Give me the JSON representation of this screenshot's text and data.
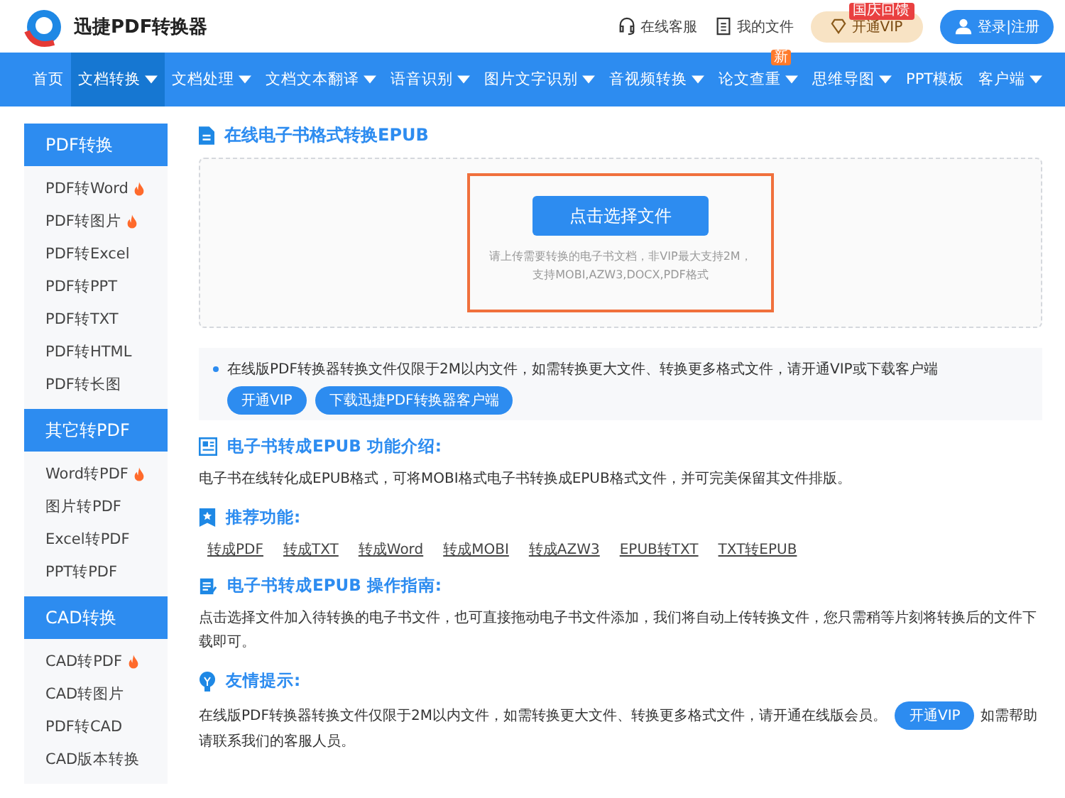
{
  "header": {
    "brand": "迅捷PDF转换器",
    "links": [
      {
        "kind": "service",
        "label": "在线客服"
      },
      {
        "kind": "files",
        "label": "我的文件"
      }
    ],
    "vip": {
      "label": "开通VIP",
      "badge": "国庆回馈"
    },
    "login": "登录|注册"
  },
  "nav": [
    {
      "label": "首页",
      "dropdown": false,
      "selected": false
    },
    {
      "label": "文档转换",
      "dropdown": true,
      "selected": true
    },
    {
      "label": "文档处理",
      "dropdown": true,
      "selected": false
    },
    {
      "label": "文档文本翻译",
      "dropdown": true,
      "selected": false
    },
    {
      "label": "语音识别",
      "dropdown": true,
      "selected": false
    },
    {
      "label": "图片文字识别",
      "dropdown": true,
      "selected": false
    },
    {
      "label": "音视频转换",
      "dropdown": true,
      "selected": false
    },
    {
      "label": "论文查重",
      "dropdown": true,
      "selected": false,
      "badge": "新"
    },
    {
      "label": "思维导图",
      "dropdown": true,
      "selected": false
    },
    {
      "label": "PPT模板",
      "dropdown": false,
      "selected": false
    },
    {
      "label": "客户端",
      "dropdown": true,
      "selected": false
    }
  ],
  "sidebar": [
    {
      "title": "PDF转换",
      "items": [
        {
          "label": "PDF转Word",
          "hot": true
        },
        {
          "label": "PDF转图片",
          "hot": true
        },
        {
          "label": "PDF转Excel",
          "hot": false
        },
        {
          "label": "PDF转PPT",
          "hot": false
        },
        {
          "label": "PDF转TXT",
          "hot": false
        },
        {
          "label": "PDF转HTML",
          "hot": false
        },
        {
          "label": "PDF转长图",
          "hot": false
        }
      ]
    },
    {
      "title": "其它转PDF",
      "items": [
        {
          "label": "Word转PDF",
          "hot": true
        },
        {
          "label": "图片转PDF",
          "hot": false
        },
        {
          "label": "Excel转PDF",
          "hot": false
        },
        {
          "label": "PPT转PDF",
          "hot": false
        }
      ]
    },
    {
      "title": "CAD转换",
      "items": [
        {
          "label": "CAD转PDF",
          "hot": true
        },
        {
          "label": "CAD转图片",
          "hot": false
        },
        {
          "label": "PDF转CAD",
          "hot": false
        },
        {
          "label": "CAD版本转换",
          "hot": false
        }
      ]
    }
  ],
  "page_title": "在线电子书格式转换EPUB",
  "upload": {
    "button": "点击选择文件",
    "hint": "请上传需要转换的电子书文档，非VIP最大支持2M，",
    "formats": "支持MOBI,AZW3,DOCX,PDF格式"
  },
  "notice": {
    "text": "在线版PDF转换器转换文件仅限于2M以内文件，如需转换更大文件、转换更多格式文件，请开通VIP或下载客户端",
    "buttons": [
      "开通VIP",
      "下载迅捷PDF转换器客户端"
    ]
  },
  "sections": [
    {
      "kind": "intro",
      "title": "电子书转成EPUB 功能介绍:",
      "text": "电子书在线转化成EPUB格式，可将MOBI格式电子书转换成EPUB格式文件，并可完美保留其文件排版。"
    },
    {
      "kind": "links",
      "title": "推荐功能:",
      "links": [
        "转成PDF",
        "转成TXT",
        "转成Word",
        "转成MOBI",
        "转成AZW3",
        "EPUB转TXT",
        "TXT转EPUB"
      ]
    },
    {
      "kind": "guide",
      "title": "电子书转成EPUB 操作指南:",
      "text": "点击选择文件加入待转换的电子书文件，也可直接拖动电子书文件添加，我们将自动上传转换文件，您只需稍等片刻将转换后的文件下载即可。"
    },
    {
      "kind": "tip",
      "title": "友情提示:",
      "text": "在线版PDF转换器转换文件仅限于2M以内文件，如需转换更大文件、转换更多格式文件，请开通在线版会员。",
      "button": "开通VIP",
      "after": "如需帮助请联系我们的客服人员。"
    }
  ]
}
